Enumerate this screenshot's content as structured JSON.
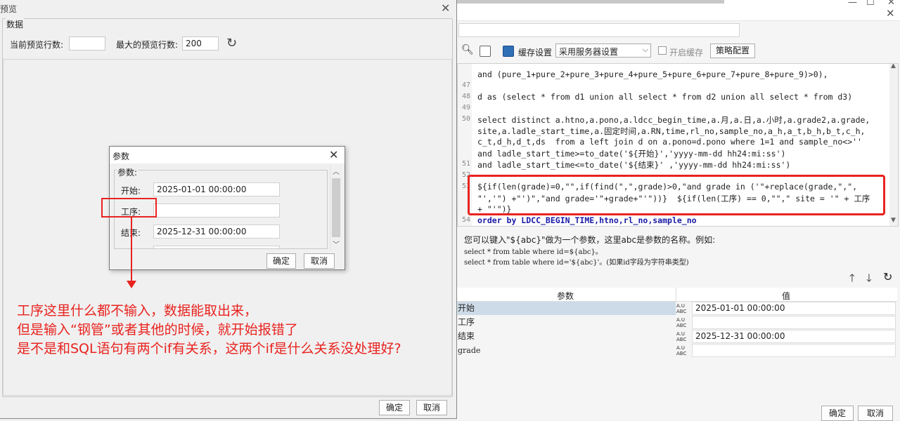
{
  "preview": {
    "title": "预览",
    "group_title": "数据",
    "current_rows_label": "当前预览行数:",
    "current_rows_value": "",
    "max_rows_label": "最大的预览行数:",
    "max_rows_value": "200",
    "ok_label": "确定",
    "cancel_label": "取消"
  },
  "params_dialog": {
    "title": "参数",
    "group_title": "参数:",
    "params": [
      {
        "label": "开始:",
        "value": "2025-01-01 00:00:00"
      },
      {
        "label": "工序:",
        "value": ""
      },
      {
        "label": "结束:",
        "value": "2025-12-31 00:00:00"
      }
    ],
    "ok_label": "确定",
    "cancel_label": "取消"
  },
  "annotation": {
    "lines": [
      "工序这里什么都不输入，数据能取出来，",
      "但是输入“钢管”或者其他的时候，就开始报错了",
      "是不是和SQL语句有两个if有关系，这两个if是什么关系没处理好?"
    ]
  },
  "editor": {
    "cache_label": "缓存设置",
    "cache_mode": "采用服务器设置",
    "enable_cache_label": "开启缓存",
    "strategy_label": "策略配置",
    "line_numbers": [
      "47",
      "48",
      "49",
      "50",
      "51",
      "52",
      "53",
      "54"
    ],
    "code_lines": {
      "l0": "and (pure_1+pure_2+pure_3+pure_4+pure_5+pure_6+pure_7+pure_8+pure_9)>0),",
      "l48": "d as (select * from d1 union all select * from d2 union all select * from d3)",
      "l50a": "select distinct a.htno,a.pono,a.ldcc_begin_time,a.月,a.日,a.小时,a.grade2,a.grade,",
      "l50b": "site,a.ladle_start_time,a.固定时间,a.RN,time,rl_no,sample_no,a_h,a_t,b_h,b_t,c_h,",
      "l50c": "c_t,d_h,d_t,ds  from a left join d on a.pono=d.pono where 1=1 and sample_no<>''",
      "l50d": "and ladle_start_time>=to_date('${开始}','yyyy-mm-dd hh24:mi:ss')",
      "l51": "and ladle_start_time<=to_date('${结束}' ,'yyyy-mm-dd hh24:mi:ss')",
      "l53a": "${if(len(grade)=0,\"\",if(find(\",\",grade)>0,\"and grade in ('\"+replace(grade,\",\",",
      "l53b": "\"','\") +\"')\",\"and grade='\"+grade+\"'\"))}  ${if(len(工序) == 0,\"\",\" site = '\" + 工序",
      "l53c": "+ \"'\")}",
      "l54": "order by LDCC_BEGIN_TIME,htno,rl_no,sample_no"
    },
    "hint_main": "您可以键入\"${abc}\"做为一个参数，这里abc是参数的名称。例如:",
    "hint_sql1": "select * from table where id=${abc}。",
    "hint_sql2": "select * from table where id='${abc}'。(如果id字段为字符串类型)",
    "table_header_param": "参数",
    "table_header_value": "值",
    "table_rows": [
      {
        "name": "开始",
        "value": "2025-01-01 00:00:00"
      },
      {
        "name": "工序",
        "value": ""
      },
      {
        "name": "结束",
        "value": "2025-12-31 00:00:00"
      },
      {
        "name": "grade",
        "value": ""
      }
    ],
    "ok_label": "确定",
    "cancel_label": "取消"
  },
  "colors": {
    "annotation_red": "#e8231f",
    "keyword_blue": "#1a1aa6",
    "string_red": "#a31515"
  }
}
